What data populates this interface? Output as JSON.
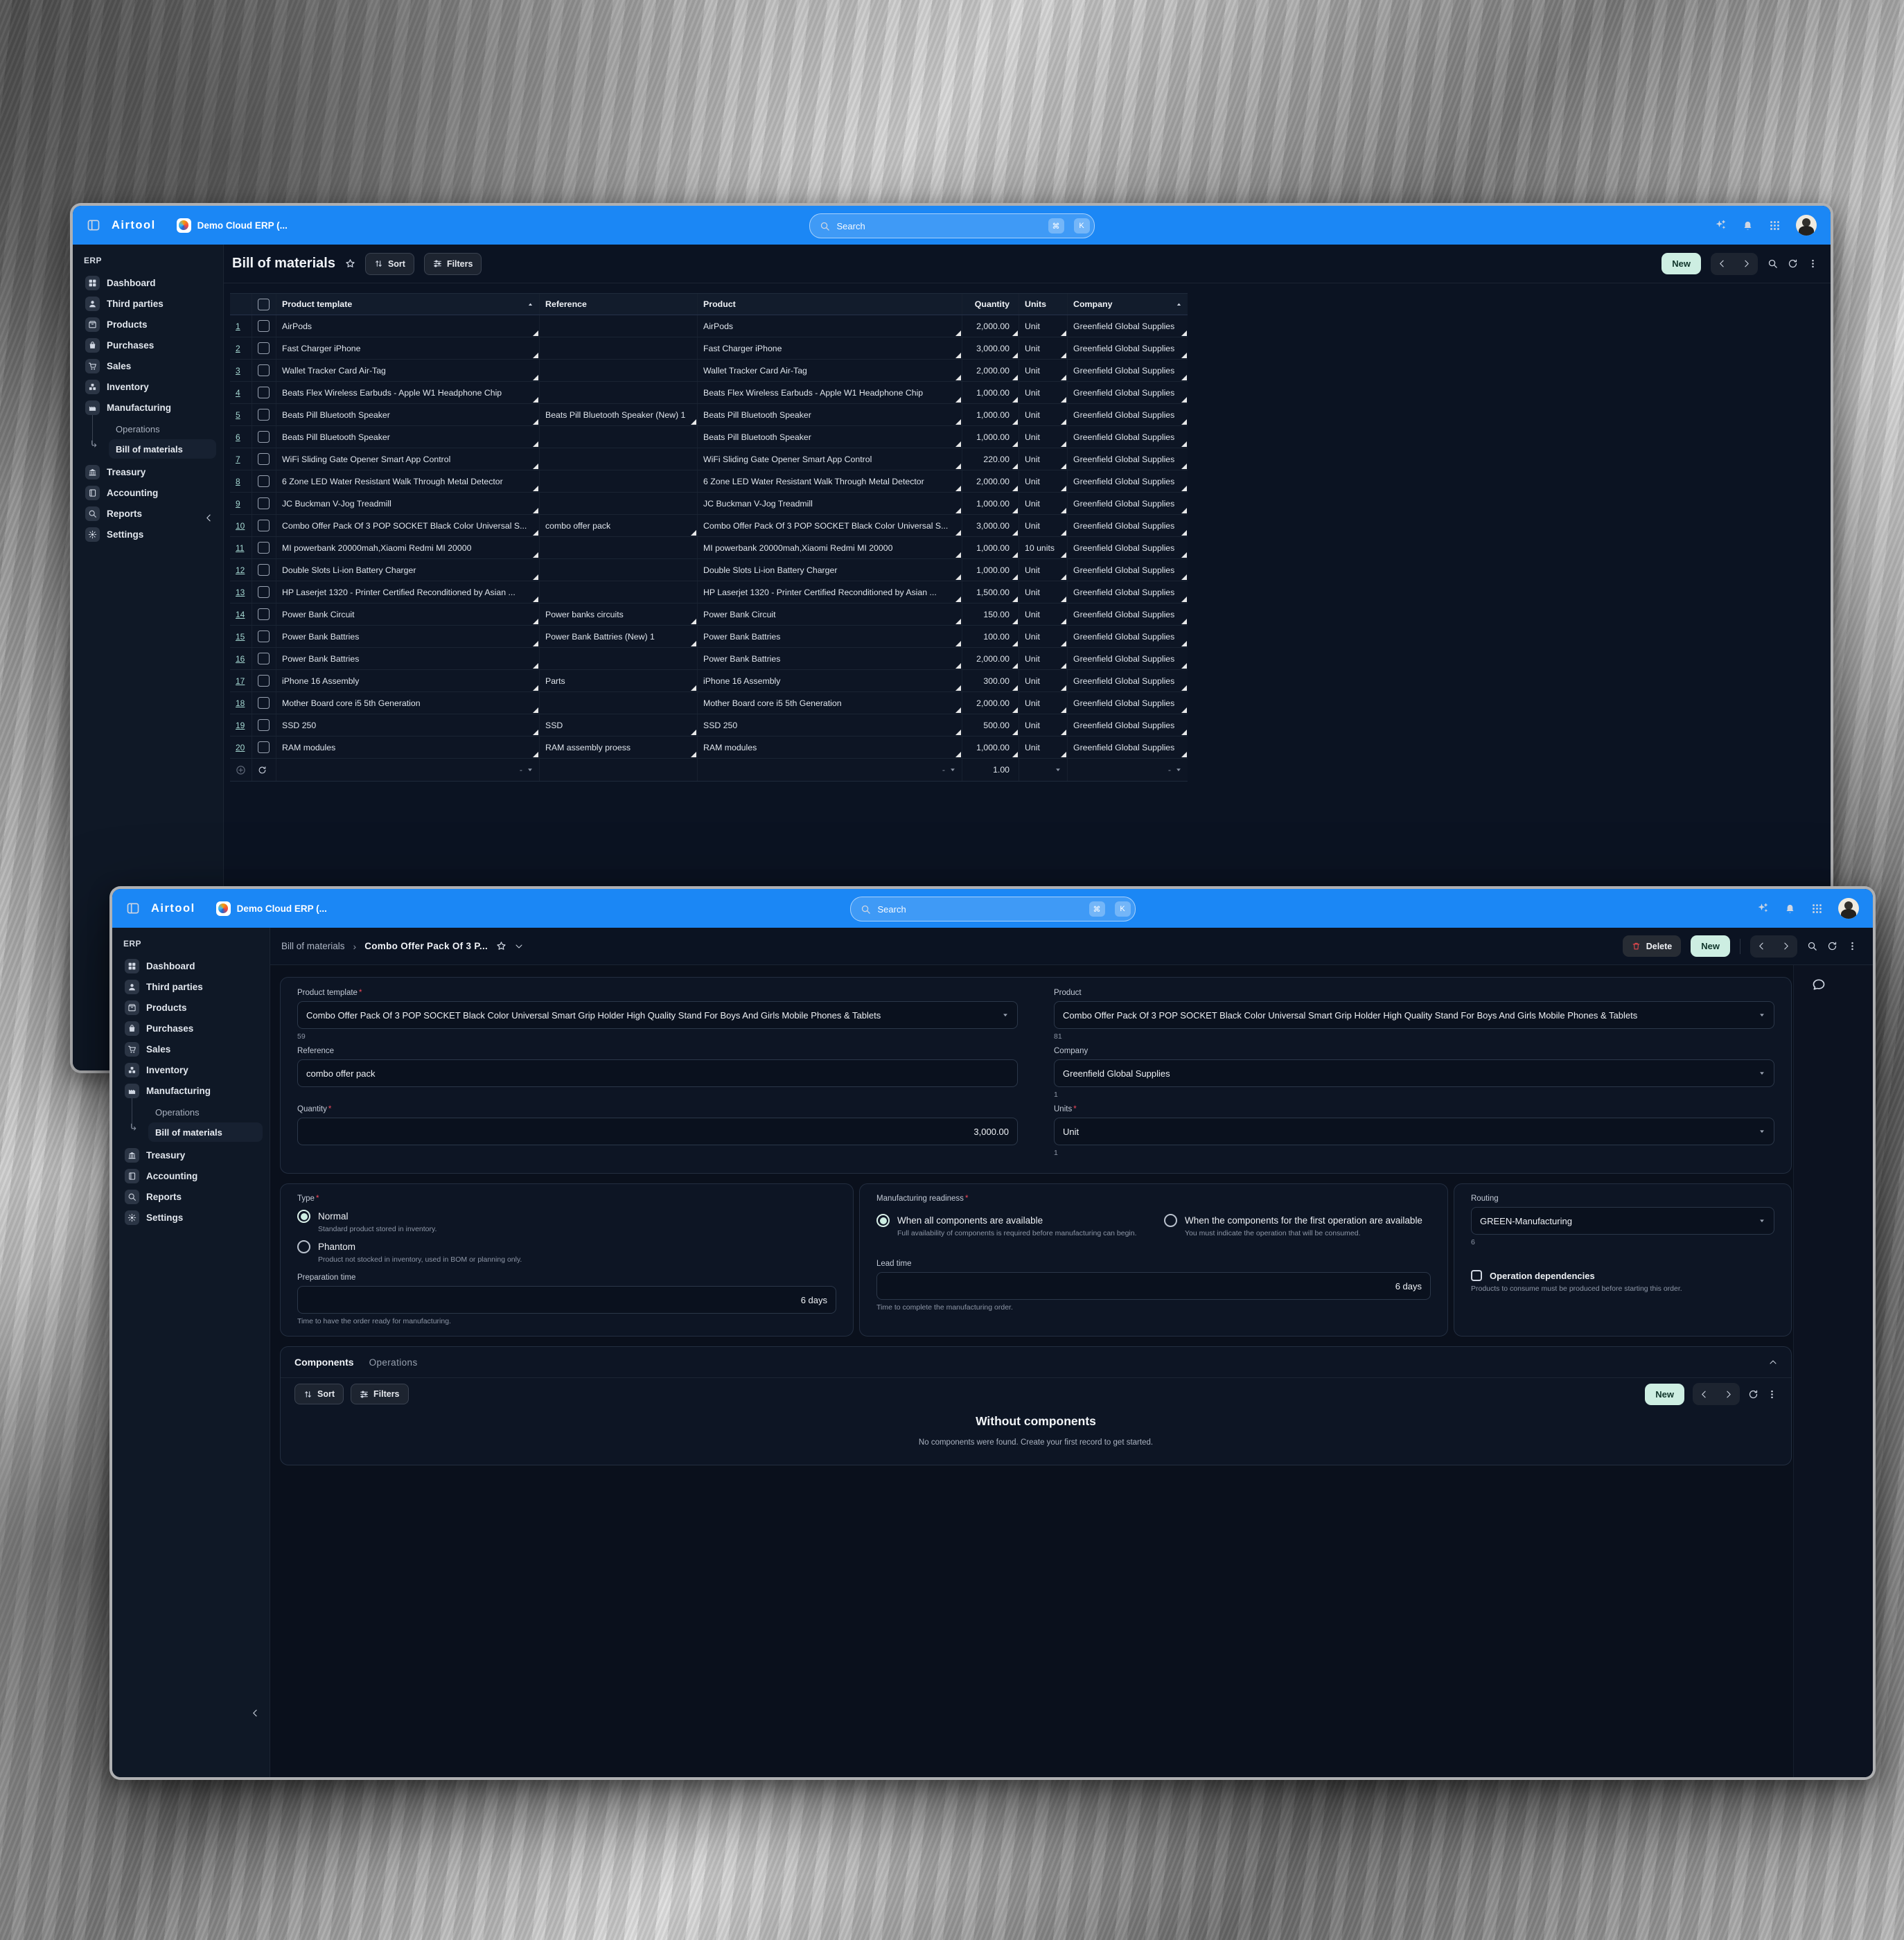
{
  "colors": {
    "accent_blue": "#1b87f5",
    "mint_accent": "#cdeee2",
    "danger_red": "#e5484d",
    "teal_link": "#a5d8d2"
  },
  "sidebar": {
    "section_label": "ERP",
    "items": [
      {
        "label": "Dashboard",
        "icon": "dashboard"
      },
      {
        "label": "Third parties",
        "icon": "users"
      },
      {
        "label": "Products",
        "icon": "products"
      },
      {
        "label": "Purchases",
        "icon": "purchases"
      },
      {
        "label": "Sales",
        "icon": "sales"
      },
      {
        "label": "Inventory",
        "icon": "inventory"
      },
      {
        "label": "Manufacturing",
        "icon": "manufacturing",
        "children": [
          {
            "label": "Operations",
            "active": false
          },
          {
            "label": "Bill of materials",
            "active": true
          }
        ]
      },
      {
        "label": "Treasury",
        "icon": "treasury"
      },
      {
        "label": "Accounting",
        "icon": "accounting"
      },
      {
        "label": "Reports",
        "icon": "reports"
      },
      {
        "label": "Settings",
        "icon": "settings"
      }
    ]
  },
  "back_window": {
    "titlebar": {
      "app_name": "Airtool",
      "tab_title": "Demo Cloud ERP (...",
      "search_placeholder": "Search",
      "shortcut_cmd": "⌘",
      "shortcut_k": "K"
    },
    "toolbar": {
      "title": "Bill of materials",
      "sort_label": "Sort",
      "filters_label": "Filters",
      "new_label": "New"
    },
    "table": {
      "headers": {
        "product_template": "Product template",
        "reference": "Reference",
        "product": "Product",
        "quantity": "Quantity",
        "units": "Units",
        "company": "Company"
      },
      "rows": [
        {
          "num": "1",
          "template": "AirPods",
          "reference": "",
          "product": "AirPods",
          "quantity": "2,000.00",
          "units": "Unit",
          "company": "Greenfield Global Supplies"
        },
        {
          "num": "2",
          "template": "Fast Charger iPhone",
          "reference": "",
          "product": "Fast Charger iPhone",
          "quantity": "3,000.00",
          "units": "Unit",
          "company": "Greenfield Global Supplies"
        },
        {
          "num": "3",
          "template": "Wallet Tracker Card Air-Tag",
          "reference": "",
          "product": "Wallet Tracker Card Air-Tag",
          "quantity": "2,000.00",
          "units": "Unit",
          "company": "Greenfield Global Supplies"
        },
        {
          "num": "4",
          "template": "Beats Flex Wireless Earbuds - Apple W1 Headphone Chip",
          "reference": "",
          "product": "Beats Flex Wireless Earbuds - Apple W1 Headphone Chip",
          "quantity": "1,000.00",
          "units": "Unit",
          "company": "Greenfield Global Supplies"
        },
        {
          "num": "5",
          "template": "Beats Pill Bluetooth Speaker",
          "reference": "Beats Pill Bluetooth Speaker (New) 1",
          "product": "Beats Pill Bluetooth Speaker",
          "quantity": "1,000.00",
          "units": "Unit",
          "company": "Greenfield Global Supplies"
        },
        {
          "num": "6",
          "template": "Beats Pill Bluetooth Speaker",
          "reference": "",
          "product": "Beats Pill Bluetooth Speaker",
          "quantity": "1,000.00",
          "units": "Unit",
          "company": "Greenfield Global Supplies"
        },
        {
          "num": "7",
          "template": "WiFi Sliding Gate Opener Smart App Control",
          "reference": "",
          "product": "WiFi Sliding Gate Opener Smart App Control",
          "quantity": "220.00",
          "units": "Unit",
          "company": "Greenfield Global Supplies"
        },
        {
          "num": "8",
          "template": "6 Zone LED Water Resistant Walk Through Metal Detector",
          "reference": "",
          "product": "6 Zone LED Water Resistant Walk Through Metal Detector",
          "quantity": "2,000.00",
          "units": "Unit",
          "company": "Greenfield Global Supplies"
        },
        {
          "num": "9",
          "template": "JC Buckman V-Jog Treadmill",
          "reference": "",
          "product": "JC Buckman V-Jog Treadmill",
          "quantity": "1,000.00",
          "units": "Unit",
          "company": "Greenfield Global Supplies"
        },
        {
          "num": "10",
          "template": "Combo Offer Pack Of 3 POP SOCKET Black Color Universal S...",
          "reference": "combo offer pack",
          "product": "Combo Offer Pack Of 3 POP SOCKET Black Color Universal S...",
          "quantity": "3,000.00",
          "units": "Unit",
          "company": "Greenfield Global Supplies"
        },
        {
          "num": "11",
          "template": "MI powerbank 20000mah,Xiaomi Redmi MI 20000",
          "reference": "",
          "product": "MI powerbank 20000mah,Xiaomi Redmi MI 20000",
          "quantity": "1,000.00",
          "units": "10 units",
          "company": "Greenfield Global Supplies"
        },
        {
          "num": "12",
          "template": "Double Slots Li-ion Battery Charger",
          "reference": "",
          "product": "Double Slots Li-ion Battery Charger",
          "quantity": "1,000.00",
          "units": "Unit",
          "company": "Greenfield Global Supplies"
        },
        {
          "num": "13",
          "template": "HP Laserjet 1320 - Printer Certified Reconditioned by Asian ...",
          "reference": "",
          "product": "HP Laserjet 1320 - Printer Certified Reconditioned by Asian ...",
          "quantity": "1,500.00",
          "units": "Unit",
          "company": "Greenfield Global Supplies"
        },
        {
          "num": "14",
          "template": "Power Bank Circuit",
          "reference": "Power banks circuits",
          "product": "Power Bank Circuit",
          "quantity": "150.00",
          "units": "Unit",
          "company": "Greenfield Global Supplies"
        },
        {
          "num": "15",
          "template": "Power Bank Battries",
          "reference": "Power Bank Battries (New) 1",
          "product": "Power Bank Battries",
          "quantity": "100.00",
          "units": "Unit",
          "company": "Greenfield Global Supplies"
        },
        {
          "num": "16",
          "template": "Power Bank Battries",
          "reference": "",
          "product": "Power Bank Battries",
          "quantity": "2,000.00",
          "units": "Unit",
          "company": "Greenfield Global Supplies"
        },
        {
          "num": "17",
          "template": "iPhone 16 Assembly",
          "reference": "Parts",
          "product": "iPhone 16 Assembly",
          "quantity": "300.00",
          "units": "Unit",
          "company": "Greenfield Global Supplies"
        },
        {
          "num": "18",
          "template": "Mother Board core i5 5th Generation",
          "reference": "",
          "product": "Mother Board core i5 5th Generation",
          "quantity": "2,000.00",
          "units": "Unit",
          "company": "Greenfield Global Supplies"
        },
        {
          "num": "19",
          "template": "SSD 250",
          "reference": "SSD",
          "product": "SSD 250",
          "quantity": "500.00",
          "units": "Unit",
          "company": "Greenfield Global Supplies"
        },
        {
          "num": "20",
          "template": "RAM modules",
          "reference": "RAM assembly proess",
          "product": "RAM modules",
          "quantity": "1,000.00",
          "units": "Unit",
          "company": "Greenfield Global Supplies"
        }
      ],
      "footer": {
        "quantity_total": "1.00",
        "empty": "-"
      }
    }
  },
  "front_window": {
    "titlebar": {
      "app_name": "Airtool",
      "tab_title": "Demo Cloud ERP (...",
      "search_placeholder": "Search",
      "shortcut_cmd": "⌘",
      "shortcut_k": "K"
    },
    "breadcrumb": {
      "parent": "Bill of materials",
      "separator": "›",
      "current": "Combo Offer Pack Of 3 P..."
    },
    "actions": {
      "delete_label": "Delete",
      "new_label": "New"
    },
    "form": {
      "product_template": {
        "label": "Product template",
        "value": "Combo Offer Pack Of 3 POP SOCKET Black Color Universal Smart Grip Holder High Quality Stand For Boys And Girls Mobile Phones & Tablets",
        "helper": "59"
      },
      "product": {
        "label": "Product",
        "value": "Combo Offer Pack Of 3 POP SOCKET Black Color Universal Smart Grip Holder High Quality Stand For Boys And Girls Mobile Phones & Tablets",
        "helper": "81"
      },
      "reference": {
        "label": "Reference",
        "value": "combo offer pack"
      },
      "company": {
        "label": "Company",
        "value": "Greenfield Global Supplies",
        "helper": "1"
      },
      "quantity": {
        "label": "Quantity",
        "value": "3,000.00"
      },
      "units": {
        "label": "Units",
        "value": "Unit",
        "helper": "1"
      },
      "type": {
        "label": "Type",
        "options": [
          {
            "label": "Normal",
            "desc": "Standard product stored in inventory.",
            "selected": true
          },
          {
            "label": "Phantom",
            "desc": "Product not stocked in inventory, used in BOM or planning only.",
            "selected": false
          }
        ]
      },
      "readiness": {
        "label": "Manufacturing readiness",
        "options": [
          {
            "label": "When all components are available",
            "desc": "Full availability of components is required before manufacturing can begin.",
            "selected": true
          },
          {
            "label": "When the components for the first operation are available",
            "desc": "You must indicate the operation that will be consumed.",
            "selected": false
          }
        ]
      },
      "preparation_time": {
        "label": "Preparation time",
        "value": "6 days",
        "helper": "Time to have the order ready for manufacturing."
      },
      "lead_time": {
        "label": "Lead time",
        "value": "6 days",
        "helper": "Time to complete the manufacturing order."
      },
      "routing": {
        "label": "Routing",
        "value": "GREEN-Manufacturing",
        "helper": "6"
      },
      "operation_dependencies": {
        "label": "Operation dependencies",
        "desc": "Products to consume must be produced before starting this order."
      }
    },
    "components_section": {
      "tabs": [
        {
          "label": "Components",
          "active": true
        },
        {
          "label": "Operations",
          "active": false
        }
      ],
      "sort_label": "Sort",
      "filters_label": "Filters",
      "new_label": "New",
      "empty_title": "Without components",
      "empty_text": "No components were found. Create your first record to get started."
    }
  }
}
